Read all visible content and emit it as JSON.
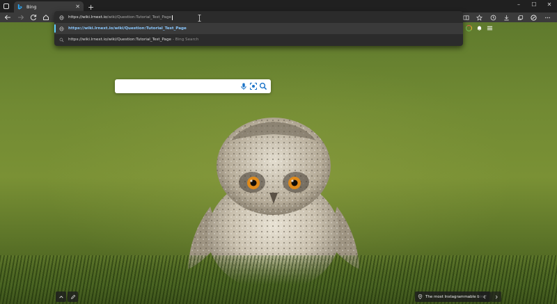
{
  "browser": {
    "tab_title": "Bing",
    "new_tab_symbol": "+",
    "tab_close_symbol": "✕",
    "window_controls": {
      "minimize": "–",
      "maximize": "☐",
      "close": "✕"
    }
  },
  "address_bar": {
    "typed_host": "https://wiki.lrnext.io",
    "typed_path": "/wiki/Question:Tutorial_Test_Page",
    "suggestions": [
      {
        "text": "https://wiki.lrnext.io/wiki/Question:Tutorial_Test_Page",
        "source": "",
        "icon": "globe-icon",
        "highlighted": true
      },
      {
        "text": "https://wiki.lrnext.io/wiki/Question:Tutorial_Test_Page",
        "source": "- Bing Search",
        "icon": "search-icon",
        "highlighted": false
      }
    ]
  },
  "toolbar_icons": [
    "split-screen-icon",
    "favorites-icon",
    "history-icon",
    "downloads-icon",
    "collections-icon",
    "copilot-icon",
    "more-icon"
  ],
  "search": {
    "value": "",
    "placeholder": ""
  },
  "footer": {
    "caption": "The most Instagrammable bird?"
  },
  "colors": {
    "accent": "#60cdff",
    "suggestion_text": "#8ac8ff",
    "tab_bar": "#202020",
    "toolbar": "#3b3b3b"
  }
}
